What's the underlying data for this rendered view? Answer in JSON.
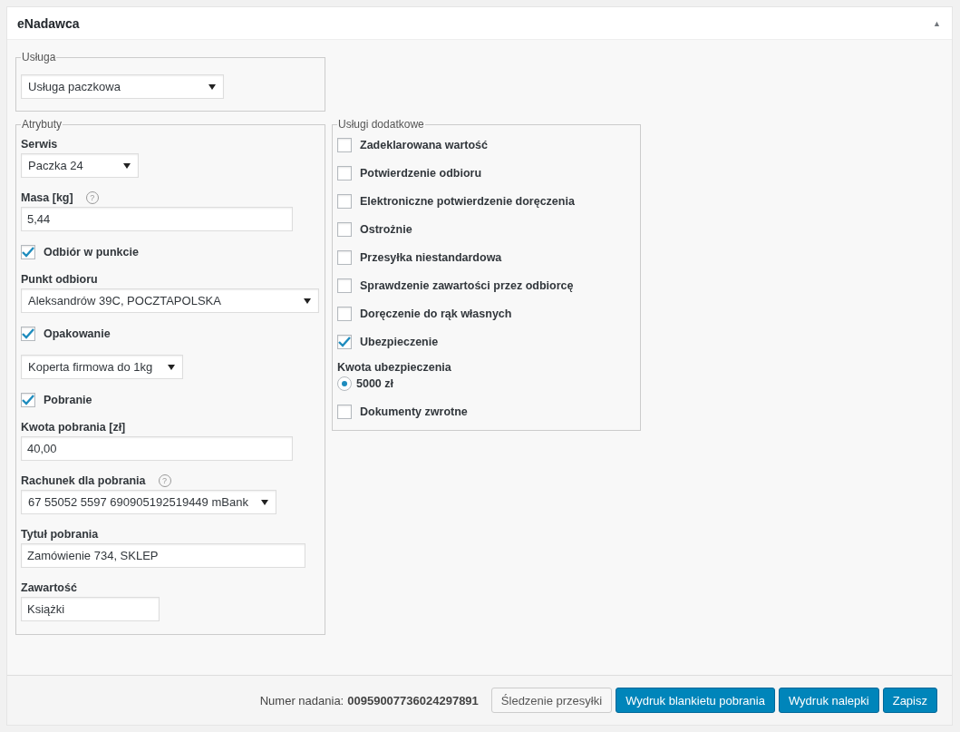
{
  "panel": {
    "title": "eNadawca",
    "collapse_glyph": "▲"
  },
  "service": {
    "legend": "Usługa",
    "value": "Usługa paczkowa"
  },
  "attributes": {
    "legend": "Atrybuty",
    "fields": [
      {
        "kind": "select",
        "label": "Serwis",
        "value": "Paczka 24"
      },
      {
        "kind": "input",
        "label": "Masa [kg]",
        "help": "?",
        "value": "5,44"
      },
      {
        "kind": "checkbox",
        "label": "Odbiór w punkcie",
        "checked": true
      },
      {
        "kind": "select",
        "label": "Punkt odbioru",
        "value": "Aleksandrów 39C, POCZTAPOLSKA"
      },
      {
        "kind": "checkbox",
        "label": "Opakowanie",
        "checked": true
      },
      {
        "kind": "select",
        "value": "Koperta firmowa do 1kg"
      },
      {
        "kind": "checkbox",
        "label": "Pobranie",
        "checked": true
      },
      {
        "kind": "input",
        "label": "Kwota pobrania [zł]",
        "value": "40,00"
      },
      {
        "kind": "select",
        "label": "Rachunek dla pobrania",
        "help": "?",
        "value": "67 55052 5597 690905192519449 mBank"
      },
      {
        "kind": "input",
        "label": "Tytuł pobrania",
        "value": "Zamówienie 734, SKLEP"
      },
      {
        "kind": "input",
        "label": "Zawartość",
        "value": "Książki"
      }
    ]
  },
  "extras": {
    "legend": "Usługi dodatkowe",
    "items": [
      {
        "kind": "checkbox",
        "label": "Zadeklarowana wartość",
        "checked": false
      },
      {
        "kind": "checkbox",
        "label": "Potwierdzenie odbioru",
        "checked": false
      },
      {
        "kind": "checkbox",
        "label": "Elektroniczne potwierdzenie doręczenia",
        "checked": false
      },
      {
        "kind": "checkbox",
        "label": "Ostrożnie",
        "checked": false
      },
      {
        "kind": "checkbox",
        "label": "Przesyłka niestandardowa",
        "checked": false
      },
      {
        "kind": "checkbox",
        "label": "Sprawdzenie zawartości przez odbiorcę",
        "checked": false
      },
      {
        "kind": "checkbox",
        "label": "Doręczenie do rąk własnych",
        "checked": false
      },
      {
        "kind": "checkbox",
        "label": "Ubezpieczenie",
        "checked": true
      },
      {
        "kind": "radio-group",
        "label": "Kwota ubezpieczenia",
        "options": [
          {
            "label": "5000 zł",
            "selected": true
          }
        ]
      },
      {
        "kind": "checkbox",
        "label": "Dokumenty zwrotne",
        "checked": false
      }
    ]
  },
  "footer": {
    "tracking_label": "Numer nadania:",
    "tracking_number": "00959007736024297891",
    "buttons": [
      {
        "kind": "secondary",
        "label": "Śledzenie przesyłki"
      },
      {
        "kind": "primary",
        "label": "Wydruk blankietu pobrania"
      },
      {
        "kind": "primary",
        "label": "Wydruk nalepki"
      },
      {
        "kind": "primary",
        "label": "Zapisz"
      }
    ]
  }
}
